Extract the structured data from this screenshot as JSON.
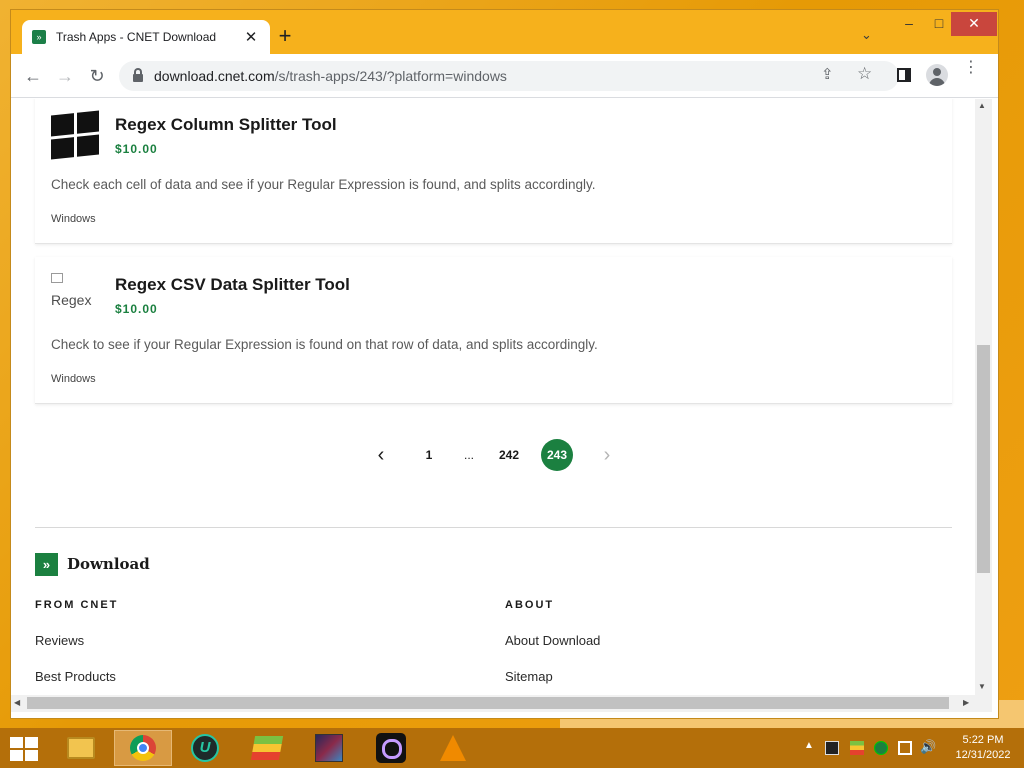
{
  "browser": {
    "tab": {
      "title": "Trash Apps - CNET Download",
      "favicon": "download-favicon",
      "close": "✕"
    },
    "new_tab": "+",
    "tab_menu": "⌄",
    "window_controls": {
      "minimize": "–",
      "maximize": "□",
      "close": "✕"
    },
    "nav": {
      "back": "←",
      "forward": "→",
      "reload": "↻"
    },
    "url": {
      "domain": "download.cnet.com",
      "path": "/s/trash-apps/243/?platform=windows"
    },
    "toolbar_icons": {
      "share": "⇪",
      "star": "☆",
      "menu": "⋮"
    }
  },
  "listing": [
    {
      "title": "Regex Column Splitter Tool",
      "price": "$10.00",
      "description": "Check each cell of data and see if your Regular Expression is found, and splits accordingly.",
      "platform": "Windows",
      "logo": "windows-logo"
    },
    {
      "title": "Regex CSV Data Splitter Tool",
      "price": "$10.00",
      "description": "Check to see if your Regular Expression is found on that row of data, and splits accordingly.",
      "platform": "Windows",
      "logo_alt": "Regex"
    }
  ],
  "pagination": {
    "prev": "‹",
    "pages": [
      "1",
      "...",
      "242",
      "243"
    ],
    "current": "243",
    "next": "›"
  },
  "footer": {
    "logo_text": "Download",
    "logo_mark": "»",
    "columns": [
      {
        "heading": "FROM CNET",
        "links": [
          "Reviews",
          "Best Products"
        ]
      },
      {
        "heading": "ABOUT",
        "links": [
          "About Download",
          "Sitemap"
        ]
      }
    ]
  },
  "scrollbars": {
    "up": "▲",
    "down": "▼",
    "left": "◀",
    "right": "▶"
  },
  "taskbar": {
    "apps": [
      "file-explorer",
      "google-chrome",
      "u-app",
      "bluestacks",
      "game-app",
      "obs-studio",
      "vlc-player"
    ],
    "active_app": "google-chrome",
    "tray_arrow": "▲",
    "volume": "🔊",
    "clock": {
      "time": "5:22 PM",
      "date": "12/31/2022"
    }
  },
  "colors": {
    "accent": "#1b8040",
    "taskbar": "#b46f0a",
    "chrome_tab_strip": "#f6b11c",
    "close_button": "#c9463d"
  }
}
